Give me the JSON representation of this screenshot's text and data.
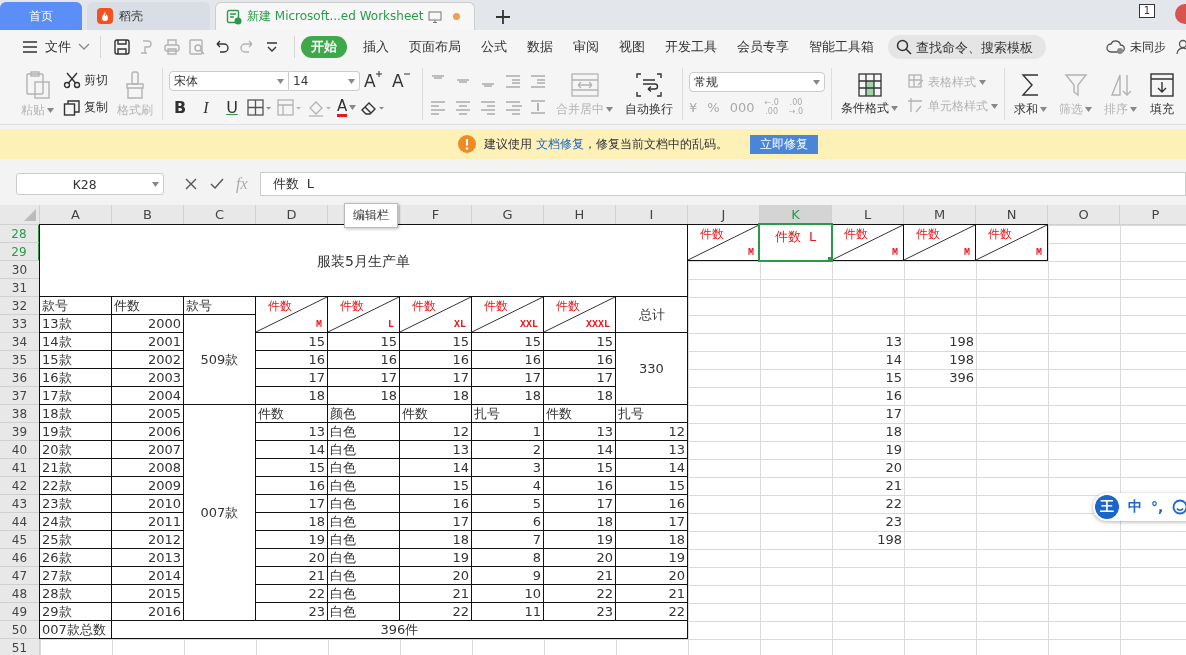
{
  "tabs": [
    {
      "label": "首页",
      "kind": "home",
      "selected": false,
      "modified": false
    },
    {
      "label": "稻壳",
      "kind": "docer",
      "selected": false,
      "modified": false
    },
    {
      "label": "新建 Microsoft...ed Worksheet",
      "kind": "sheet",
      "selected": true,
      "modified": true
    }
  ],
  "window_badge": "1",
  "menu": {
    "file": "文件",
    "quick_tools": [
      {
        "kind": "save",
        "disabled": false
      },
      {
        "kind": "format",
        "disabled": true
      },
      {
        "kind": "print",
        "disabled": true
      },
      {
        "kind": "preview",
        "disabled": true
      },
      {
        "kind": "undo",
        "disabled": false
      },
      {
        "kind": "redo",
        "disabled": true
      },
      {
        "kind": "more",
        "disabled": false
      }
    ],
    "tabs": [
      {
        "label": "开始",
        "selected": true
      },
      {
        "label": "插入",
        "selected": false
      },
      {
        "label": "页面布局",
        "selected": false
      },
      {
        "label": "公式",
        "selected": false
      },
      {
        "label": "数据",
        "selected": false
      },
      {
        "label": "审阅",
        "selected": false
      },
      {
        "label": "视图",
        "selected": false
      },
      {
        "label": "开发工具",
        "selected": false
      },
      {
        "label": "会员专享",
        "selected": false
      },
      {
        "label": "智能工具箱",
        "selected": false
      }
    ],
    "search": {
      "placeholder": "查找命令、搜索模板"
    },
    "sync": "未同步"
  },
  "ribbon": {
    "clipboard": [
      {
        "label": "粘贴",
        "kind": "paste",
        "disabled": true
      },
      {
        "label": "剪切",
        "kind": "cut",
        "disabled": false
      },
      {
        "label": "复制",
        "kind": "copy",
        "disabled": false
      },
      {
        "label": "格式刷",
        "kind": "painter",
        "disabled": true
      }
    ],
    "font": {
      "name": "宋体",
      "size": "14"
    },
    "size_buttons": [
      {
        "label": "A",
        "kind": "grow"
      },
      {
        "label": "A",
        "kind": "shrink"
      }
    ],
    "style_buttons": [
      {
        "label": "B",
        "kind": "bold"
      },
      {
        "label": "I",
        "kind": "italic"
      },
      {
        "label": "U",
        "kind": "underline"
      }
    ],
    "font_color": {
      "label": "A",
      "color": "#e8191c"
    },
    "merge": {
      "label": "合并居中",
      "disabled": true
    },
    "wrap": {
      "label": "自动换行",
      "disabled": false
    },
    "number_format": "常规",
    "number_buttons": [
      {
        "kind": "currency",
        "label": "¥"
      },
      {
        "kind": "percent",
        "label": "%"
      },
      {
        "kind": "thousands",
        "label": "000"
      },
      {
        "kind": "decimal",
        "top": "←.0",
        "bottom": ".00"
      },
      {
        "kind": "decimal",
        "top": ".00",
        "bottom": "→.0"
      }
    ],
    "styles": [
      {
        "label": "条件格式",
        "kind": "conditional",
        "disabled": false
      },
      {
        "label": "表格样式",
        "kind": "table",
        "disabled": true
      },
      {
        "label": "单元格样式",
        "kind": "cell",
        "disabled": true
      }
    ],
    "edit": [
      {
        "label": "求和",
        "kind": "sum",
        "disabled": false
      },
      {
        "label": "筛选",
        "kind": "filter",
        "disabled": true
      },
      {
        "label": "排序",
        "kind": "sort",
        "disabled": true
      },
      {
        "label": "填充",
        "kind": "fill",
        "disabled": false
      }
    ]
  },
  "notice": {
    "before": "建议使用",
    "link": "文档修复",
    "after": "，修复当前文档中的乱码。",
    "button": "立即修复"
  },
  "formula_bar": {
    "name_box": "K28",
    "fx": "fx",
    "value": "件数  L"
  },
  "tooltip": "编辑栏",
  "sheet": {
    "columns": [
      {
        "label": "A",
        "selected": false
      },
      {
        "label": "B",
        "selected": false
      },
      {
        "label": "C",
        "selected": false
      },
      {
        "label": "D",
        "selected": false
      },
      {
        "selected": false
      },
      {
        "label": "F",
        "selected": false
      },
      {
        "label": "G",
        "selected": false
      },
      {
        "label": "H",
        "selected": false
      },
      {
        "label": "I",
        "selected": false
      },
      {
        "label": "J",
        "selected": false
      },
      {
        "label": "K",
        "selected": true
      },
      {
        "label": "L",
        "selected": false
      },
      {
        "label": "M",
        "selected": false
      },
      {
        "label": "N",
        "selected": false
      },
      {
        "label": "O",
        "selected": false
      },
      {
        "label": "P",
        "selected": false
      }
    ],
    "rows": [
      {
        "label": "28",
        "selected": true,
        "cells": [
          {
            "kind": "title",
            "text": "服装5月生产单",
            "selected": false
          },
          {
            "kind": "join-left"
          },
          {
            "kind": "join-left"
          },
          {
            "kind": "join-left"
          },
          {
            "kind": "join-left"
          },
          {
            "kind": "join-left"
          },
          {
            "kind": "join-left"
          },
          {
            "kind": "join-left"
          },
          {
            "kind": "join-left"
          },
          {
            "kind": "diag",
            "text": "件数",
            "corner": "M",
            "selected": false
          },
          {
            "kind": "red",
            "text": "件数  L",
            "selected": true
          },
          {
            "kind": "diag",
            "text": "件数",
            "corner": "M",
            "selected": false
          },
          {
            "kind": "diag",
            "text": "件数",
            "corner": "M",
            "selected": false
          },
          {
            "kind": "diag",
            "text": "件数",
            "corner": "M",
            "selected": false
          }
        ]
      },
      {
        "label": "29",
        "selected": true,
        "cells": [
          {
            "kind": "join-up"
          },
          {
            "kind": "join-up"
          },
          {
            "kind": "join-up"
          },
          {
            "kind": "join-up"
          },
          {
            "kind": "join-up"
          },
          {
            "kind": "join-up"
          },
          {
            "kind": "join-up"
          },
          {
            "kind": "join-up"
          },
          {
            "kind": "join-up"
          },
          {
            "kind": "join-up"
          },
          {
            "kind": "join-up"
          },
          {
            "kind": "join-up"
          },
          {
            "kind": "join-up"
          },
          {
            "kind": "join-up"
          }
        ]
      },
      {
        "label": "30",
        "selected": false,
        "cells": [
          {
            "kind": "join-up"
          },
          {
            "kind": "join-up"
          },
          {
            "kind": "join-up"
          },
          {
            "kind": "join-up"
          },
          {
            "kind": "join-up"
          },
          {
            "kind": "join-up"
          },
          {
            "kind": "join-up"
          },
          {
            "kind": "join-up"
          },
          {
            "kind": "join-up"
          }
        ]
      },
      {
        "label": "31",
        "selected": false,
        "cells": [
          {
            "kind": "join-up"
          },
          {
            "kind": "join-up"
          },
          {
            "kind": "join-up"
          },
          {
            "kind": "join-up"
          },
          {
            "kind": "join-up"
          },
          {
            "kind": "join-up"
          },
          {
            "kind": "join-up"
          },
          {
            "kind": "join-up"
          },
          {
            "kind": "join-up"
          }
        ]
      },
      {
        "label": "32",
        "selected": false,
        "cells": [
          {
            "kind": "text",
            "text": "款号",
            "selected": false
          },
          {
            "kind": "text",
            "text": "件数",
            "selected": false
          },
          {
            "kind": "text",
            "text": "款号",
            "selected": false
          },
          {
            "kind": "diag",
            "text": "件数",
            "corner": "M",
            "selected": false
          },
          {
            "kind": "diag",
            "text": "件数",
            "corner": "L",
            "selected": false
          },
          {
            "kind": "diag",
            "text": "件数",
            "corner": "XL",
            "selected": false
          },
          {
            "kind": "diag",
            "text": "件数",
            "corner": "XXL",
            "selected": false
          },
          {
            "kind": "diag",
            "text": "件数",
            "corner": "XXXL",
            "selected": false
          },
          {
            "kind": "center",
            "text": "总计",
            "selected": false
          }
        ]
      },
      {
        "label": "33",
        "selected": false,
        "cells": [
          {
            "kind": "text",
            "text": "13款",
            "selected": false
          },
          {
            "kind": "num",
            "text": "2000",
            "selected": false
          },
          {
            "kind": "center",
            "text": "509款",
            "selected": false
          },
          {
            "kind": "join-up"
          },
          {
            "kind": "join-up"
          },
          {
            "kind": "join-up"
          },
          {
            "kind": "join-up"
          },
          {
            "kind": "join-up"
          },
          {
            "kind": "join-up"
          }
        ]
      },
      {
        "label": "34",
        "selected": false,
        "cells": [
          {
            "kind": "text",
            "text": "14款",
            "selected": false
          },
          {
            "kind": "num",
            "text": "2001",
            "selected": false
          },
          {
            "kind": "join-up"
          },
          {
            "kind": "num",
            "text": "15",
            "selected": false
          },
          {
            "kind": "num",
            "text": "15",
            "selected": false
          },
          {
            "kind": "num",
            "text": "15",
            "selected": false
          },
          {
            "kind": "num",
            "text": "15",
            "selected": false
          },
          {
            "kind": "num",
            "text": "15",
            "selected": false
          },
          {
            "kind": "center",
            "text": "330",
            "selected": false
          },
          {
            "kind": "empty"
          },
          {
            "kind": "empty"
          },
          {
            "kind": "loose",
            "text": "13",
            "selected": false
          },
          {
            "kind": "loose",
            "text": "198",
            "selected": false
          }
        ]
      },
      {
        "label": "35",
        "selected": false,
        "cells": [
          {
            "kind": "text",
            "text": "15款",
            "selected": false
          },
          {
            "kind": "num",
            "text": "2002",
            "selected": false
          },
          {
            "kind": "join-up"
          },
          {
            "kind": "num",
            "text": "16",
            "selected": false
          },
          {
            "kind": "num",
            "text": "16",
            "selected": false
          },
          {
            "kind": "num",
            "text": "16",
            "selected": false
          },
          {
            "kind": "num",
            "text": "16",
            "selected": false
          },
          {
            "kind": "num",
            "text": "16",
            "selected": false
          },
          {
            "kind": "join-up"
          },
          {
            "kind": "empty"
          },
          {
            "kind": "empty"
          },
          {
            "kind": "loose",
            "text": "14",
            "selected": false
          },
          {
            "kind": "loose",
            "text": "198",
            "selected": false
          }
        ]
      },
      {
        "label": "36",
        "selected": false,
        "cells": [
          {
            "kind": "text",
            "text": "16款",
            "selected": false
          },
          {
            "kind": "num",
            "text": "2003",
            "selected": false
          },
          {
            "kind": "join-up"
          },
          {
            "kind": "num",
            "text": "17",
            "selected": false
          },
          {
            "kind": "num",
            "text": "17",
            "selected": false
          },
          {
            "kind": "num",
            "text": "17",
            "selected": false
          },
          {
            "kind": "num",
            "text": "17",
            "selected": false
          },
          {
            "kind": "num",
            "text": "17",
            "selected": false
          },
          {
            "kind": "join-up"
          },
          {
            "kind": "empty"
          },
          {
            "kind": "empty"
          },
          {
            "kind": "loose",
            "text": "15",
            "selected": false
          },
          {
            "kind": "loose",
            "text": "396",
            "selected": false
          }
        ]
      },
      {
        "label": "37",
        "selected": false,
        "cells": [
          {
            "kind": "text",
            "text": "17款",
            "selected": false
          },
          {
            "kind": "num",
            "text": "2004",
            "selected": false
          },
          {
            "kind": "join-up"
          },
          {
            "kind": "num",
            "text": "18",
            "selected": false
          },
          {
            "kind": "num",
            "text": "18",
            "selected": false
          },
          {
            "kind": "num",
            "text": "18",
            "selected": false
          },
          {
            "kind": "num",
            "text": "18",
            "selected": false
          },
          {
            "kind": "num",
            "text": "18",
            "selected": false
          },
          {
            "kind": "join-up"
          },
          {
            "kind": "empty"
          },
          {
            "kind": "empty"
          },
          {
            "kind": "loose",
            "text": "16",
            "selected": false
          }
        ]
      },
      {
        "label": "38",
        "selected": false,
        "cells": [
          {
            "kind": "text",
            "text": "18款",
            "selected": false
          },
          {
            "kind": "num",
            "text": "2005",
            "selected": false
          },
          {
            "kind": "center",
            "text": "007款",
            "selected": false
          },
          {
            "kind": "text",
            "text": "件数",
            "selected": false
          },
          {
            "kind": "text",
            "text": "颜色",
            "selected": false
          },
          {
            "kind": "text",
            "text": "件数",
            "selected": false
          },
          {
            "kind": "text",
            "text": "扎号",
            "selected": false
          },
          {
            "kind": "text",
            "text": "件数",
            "selected": false
          },
          {
            "kind": "text",
            "text": "扎号",
            "selected": false
          },
          {
            "kind": "empty"
          },
          {
            "kind": "empty"
          },
          {
            "kind": "loose",
            "text": "17",
            "selected": false
          }
        ]
      },
      {
        "label": "39",
        "selected": false,
        "cells": [
          {
            "kind": "text",
            "text": "19款",
            "selected": false
          },
          {
            "kind": "num",
            "text": "2006",
            "selected": false
          },
          {
            "kind": "join-up"
          },
          {
            "kind": "num",
            "text": "13",
            "selected": false
          },
          {
            "kind": "text",
            "text": "白色",
            "selected": false
          },
          {
            "kind": "num",
            "text": "12",
            "selected": false
          },
          {
            "kind": "num",
            "text": "1",
            "selected": false
          },
          {
            "kind": "num",
            "text": "13",
            "selected": false
          },
          {
            "kind": "num",
            "text": "12",
            "selected": false
          },
          {
            "kind": "empty"
          },
          {
            "kind": "empty"
          },
          {
            "kind": "loose",
            "text": "18",
            "selected": false
          }
        ]
      },
      {
        "label": "40",
        "selected": false,
        "cells": [
          {
            "kind": "text",
            "text": "20款",
            "selected": false
          },
          {
            "kind": "num",
            "text": "2007",
            "selected": false
          },
          {
            "kind": "join-up"
          },
          {
            "kind": "num",
            "text": "14",
            "selected": false
          },
          {
            "kind": "text",
            "text": "白色",
            "selected": false
          },
          {
            "kind": "num",
            "text": "13",
            "selected": false
          },
          {
            "kind": "num",
            "text": "2",
            "selected": false
          },
          {
            "kind": "num",
            "text": "14",
            "selected": false
          },
          {
            "kind": "num",
            "text": "13",
            "selected": false
          },
          {
            "kind": "empty"
          },
          {
            "kind": "empty"
          },
          {
            "kind": "loose",
            "text": "19",
            "selected": false
          }
        ]
      },
      {
        "label": "41",
        "selected": false,
        "cells": [
          {
            "kind": "text",
            "text": "21款",
            "selected": false
          },
          {
            "kind": "num",
            "text": "2008",
            "selected": false
          },
          {
            "kind": "join-up"
          },
          {
            "kind": "num",
            "text": "15",
            "selected": false
          },
          {
            "kind": "text",
            "text": "白色",
            "selected": false
          },
          {
            "kind": "num",
            "text": "14",
            "selected": false
          },
          {
            "kind": "num",
            "text": "3",
            "selected": false
          },
          {
            "kind": "num",
            "text": "15",
            "selected": false
          },
          {
            "kind": "num",
            "text": "14",
            "selected": false
          },
          {
            "kind": "empty"
          },
          {
            "kind": "empty"
          },
          {
            "kind": "loose",
            "text": "20",
            "selected": false
          }
        ]
      },
      {
        "label": "42",
        "selected": false,
        "cells": [
          {
            "kind": "text",
            "text": "22款",
            "selected": false
          },
          {
            "kind": "num",
            "text": "2009",
            "selected": false
          },
          {
            "kind": "join-up"
          },
          {
            "kind": "num",
            "text": "16",
            "selected": false
          },
          {
            "kind": "text",
            "text": "白色",
            "selected": false
          },
          {
            "kind": "num",
            "text": "15",
            "selected": false
          },
          {
            "kind": "num",
            "text": "4",
            "selected": false
          },
          {
            "kind": "num",
            "text": "16",
            "selected": false
          },
          {
            "kind": "num",
            "text": "15",
            "selected": false
          },
          {
            "kind": "empty"
          },
          {
            "kind": "empty"
          },
          {
            "kind": "loose",
            "text": "21",
            "selected": false
          }
        ]
      },
      {
        "label": "43",
        "selected": false,
        "cells": [
          {
            "kind": "text",
            "text": "23款",
            "selected": false
          },
          {
            "kind": "num",
            "text": "2010",
            "selected": false
          },
          {
            "kind": "join-up"
          },
          {
            "kind": "num",
            "text": "17",
            "selected": false
          },
          {
            "kind": "text",
            "text": "白色",
            "selected": false
          },
          {
            "kind": "num",
            "text": "16",
            "selected": false
          },
          {
            "kind": "num",
            "text": "5",
            "selected": false
          },
          {
            "kind": "num",
            "text": "17",
            "selected": false
          },
          {
            "kind": "num",
            "text": "16",
            "selected": false
          },
          {
            "kind": "empty"
          },
          {
            "kind": "empty"
          },
          {
            "kind": "loose",
            "text": "22",
            "selected": false
          }
        ]
      },
      {
        "label": "44",
        "selected": false,
        "cells": [
          {
            "kind": "text",
            "text": "24款",
            "selected": false
          },
          {
            "kind": "num",
            "text": "2011",
            "selected": false
          },
          {
            "kind": "join-up"
          },
          {
            "kind": "num",
            "text": "18",
            "selected": false
          },
          {
            "kind": "text",
            "text": "白色",
            "selected": false
          },
          {
            "kind": "num",
            "text": "17",
            "selected": false
          },
          {
            "kind": "num",
            "text": "6",
            "selected": false
          },
          {
            "kind": "num",
            "text": "18",
            "selected": false
          },
          {
            "kind": "num",
            "text": "17",
            "selected": false
          },
          {
            "kind": "empty"
          },
          {
            "kind": "empty"
          },
          {
            "kind": "loose",
            "text": "23",
            "selected": false
          }
        ]
      },
      {
        "label": "45",
        "selected": false,
        "cells": [
          {
            "kind": "text",
            "text": "25款",
            "selected": false
          },
          {
            "kind": "num",
            "text": "2012",
            "selected": false
          },
          {
            "kind": "join-up"
          },
          {
            "kind": "num",
            "text": "19",
            "selected": false
          },
          {
            "kind": "text",
            "text": "白色",
            "selected": false
          },
          {
            "kind": "num",
            "text": "18",
            "selected": false
          },
          {
            "kind": "num",
            "text": "7",
            "selected": false
          },
          {
            "kind": "num",
            "text": "19",
            "selected": false
          },
          {
            "kind": "num",
            "text": "18",
            "selected": false
          },
          {
            "kind": "empty"
          },
          {
            "kind": "empty"
          },
          {
            "kind": "loose",
            "text": "198",
            "selected": false
          }
        ]
      },
      {
        "label": "46",
        "selected": false,
        "cells": [
          {
            "kind": "text",
            "text": "26款",
            "selected": false
          },
          {
            "kind": "num",
            "text": "2013",
            "selected": false
          },
          {
            "kind": "join-up"
          },
          {
            "kind": "num",
            "text": "20",
            "selected": false
          },
          {
            "kind": "text",
            "text": "白色",
            "selected": false
          },
          {
            "kind": "num",
            "text": "19",
            "selected": false
          },
          {
            "kind": "num",
            "text": "8",
            "selected": false
          },
          {
            "kind": "num",
            "text": "20",
            "selected": false
          },
          {
            "kind": "num",
            "text": "19",
            "selected": false
          }
        ]
      },
      {
        "label": "47",
        "selected": false,
        "cells": [
          {
            "kind": "text",
            "text": "27款",
            "selected": false
          },
          {
            "kind": "num",
            "text": "2014",
            "selected": false
          },
          {
            "kind": "join-up"
          },
          {
            "kind": "num",
            "text": "21",
            "selected": false
          },
          {
            "kind": "text",
            "text": "白色",
            "selected": false
          },
          {
            "kind": "num",
            "text": "20",
            "selected": false
          },
          {
            "kind": "num",
            "text": "9",
            "selected": false
          },
          {
            "kind": "num",
            "text": "21",
            "selected": false
          },
          {
            "kind": "num",
            "text": "20",
            "selected": false
          }
        ]
      },
      {
        "label": "48",
        "selected": false,
        "cells": [
          {
            "kind": "text",
            "text": "28款",
            "selected": false
          },
          {
            "kind": "num",
            "text": "2015",
            "selected": false
          },
          {
            "kind": "join-up"
          },
          {
            "kind": "num",
            "text": "22",
            "selected": false
          },
          {
            "kind": "text",
            "text": "白色",
            "selected": false
          },
          {
            "kind": "num",
            "text": "21",
            "selected": false
          },
          {
            "kind": "num",
            "text": "10",
            "selected": false
          },
          {
            "kind": "num",
            "text": "22",
            "selected": false
          },
          {
            "kind": "num",
            "text": "21",
            "selected": false
          }
        ]
      },
      {
        "label": "49",
        "selected": false,
        "cells": [
          {
            "kind": "text",
            "text": "29款",
            "selected": false
          },
          {
            "kind": "num",
            "text": "2016",
            "selected": false
          },
          {
            "kind": "join-up"
          },
          {
            "kind": "num",
            "text": "23",
            "selected": false
          },
          {
            "kind": "text",
            "text": "白色",
            "selected": false
          },
          {
            "kind": "num",
            "text": "22",
            "selected": false
          },
          {
            "kind": "num",
            "text": "11",
            "selected": false
          },
          {
            "kind": "num",
            "text": "23",
            "selected": false
          },
          {
            "kind": "num",
            "text": "22",
            "selected": false
          }
        ]
      },
      {
        "label": "50",
        "selected": false,
        "cells": [
          {
            "kind": "text",
            "text": "007款总数",
            "selected": false
          },
          {
            "kind": "center",
            "text": "396件",
            "selected": false
          },
          {
            "kind": "join-left"
          },
          {
            "kind": "join-left"
          },
          {
            "kind": "join-left"
          },
          {
            "kind": "join-left"
          },
          {
            "kind": "join-left"
          },
          {
            "kind": "join-left"
          },
          {
            "kind": "join-left"
          }
        ]
      },
      {
        "label": "51",
        "selected": false
      }
    ]
  },
  "ime": {
    "logo": "王",
    "mode": "中",
    "punct": "°,"
  }
}
